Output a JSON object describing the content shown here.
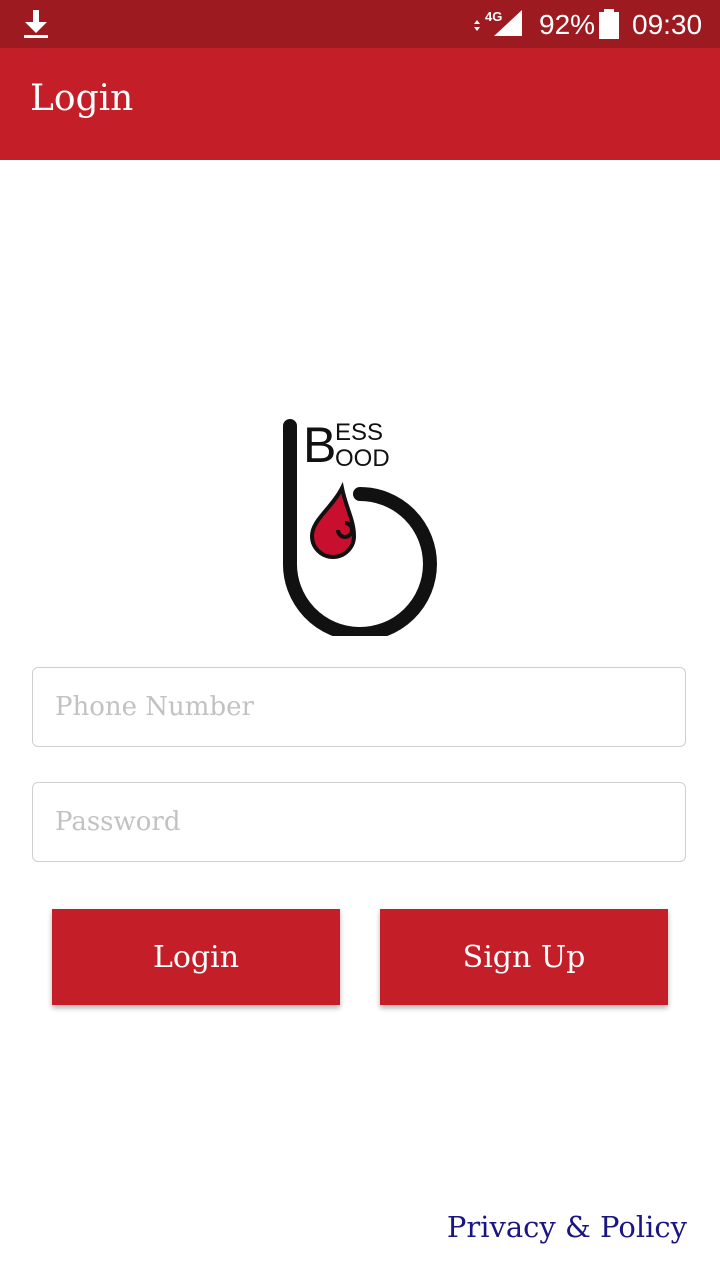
{
  "status_bar": {
    "network": "4G",
    "battery_percent": "92%",
    "time": "09:30",
    "icons": [
      "download-icon",
      "data-arrows-icon",
      "signal-icon",
      "battery-icon"
    ]
  },
  "app_bar": {
    "title": "Login"
  },
  "logo": {
    "top_text": "ESS",
    "bottom_text": "OOD",
    "initial": "B"
  },
  "form": {
    "phone_placeholder": "Phone Number",
    "phone_value": "",
    "password_placeholder": "Password",
    "password_value": ""
  },
  "buttons": {
    "login": "Login",
    "signup": "Sign Up"
  },
  "footer": {
    "privacy_link": "Privacy & Policy"
  },
  "colors": {
    "primary": "#c41e29",
    "status_bar": "#9c1a20",
    "link": "#1a1582",
    "drop": "#c8102e"
  }
}
